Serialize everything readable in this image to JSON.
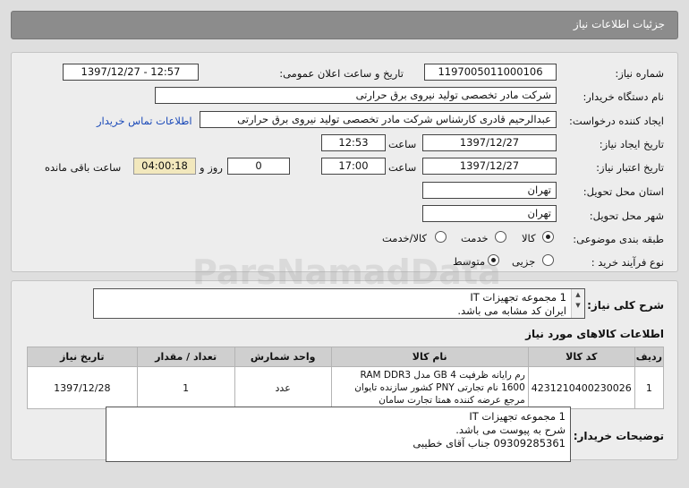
{
  "header": {
    "title": "جزئیات اطلاعات نیاز"
  },
  "form": {
    "need_number_label": "شماره نیاز:",
    "need_number": "1197005011000106",
    "announce_label": "تاریخ و ساعت اعلان عمومی:",
    "announce_value": "1397/12/27 - 12:57",
    "buyer_org_label": "نام دستگاه خریدار:",
    "buyer_org": "شرکت مادر تخصصی تولید نیروی برق حرارتی",
    "requester_label": "ایجاد کننده درخواست:",
    "requester": "عبدالرحیم قادری کارشناس شرکت مادر تخصصی تولید نیروی برق حرارتی",
    "contact_link": "اطلاعات تماس خریدار",
    "created_label": "تاریخ ایجاد نیاز:",
    "created_date": "1397/12/27",
    "time_label": "ساعت",
    "created_time": "12:53",
    "valid_label": "تاریخ اعتبار نیاز:",
    "valid_date": "1397/12/27",
    "valid_time": "17:00",
    "days_value": "0",
    "days_label": "روز و",
    "remaining_value": "04:00:18",
    "remaining_label": "ساعت باقی مانده",
    "province_label": "استان محل تحویل:",
    "province": "تهران",
    "city_label": "شهر محل تحویل:",
    "city": "تهران",
    "category_label": "طبقه بندی موضوعی:",
    "category_options": [
      "کالا",
      "خدمت",
      "کالا/خدمت"
    ],
    "category_selected": "کالا",
    "process_label": "نوع فرآیند خرید :",
    "process_options": [
      "جزیی",
      "متوسط"
    ],
    "process_selected": "متوسط"
  },
  "summary": {
    "label": "شرح کلی نیاز:",
    "line1": "1 مجموعه تجهیزات IT",
    "line2": "ایران کد مشابه می باشد."
  },
  "goods": {
    "title": "اطلاعات کالاهای مورد نیاز",
    "columns": [
      "ردیف",
      "کد کالا",
      "نام کالا",
      "واحد شمارش",
      "تعداد / مقدار",
      "تاریخ نیاز"
    ],
    "rows": [
      {
        "row": "1",
        "code": "4231210400230026",
        "name": "رم رایانه ظرفیت 4 GB مدل RAM DDR3 1600 نام تجارتی PNY کشور سازنده تایوان مرجع عرضه کننده همتا تجارت سامان",
        "unit": "عدد",
        "qty": "1",
        "date": "1397/12/28"
      }
    ]
  },
  "buyer_notes": {
    "label": "توضیحات خریدار:",
    "line1": "1 مجموعه تجهیزات IT",
    "line2": "شرح به پیوست می باشد.",
    "line3": "09309285361 جناب آقای خطیبی"
  }
}
